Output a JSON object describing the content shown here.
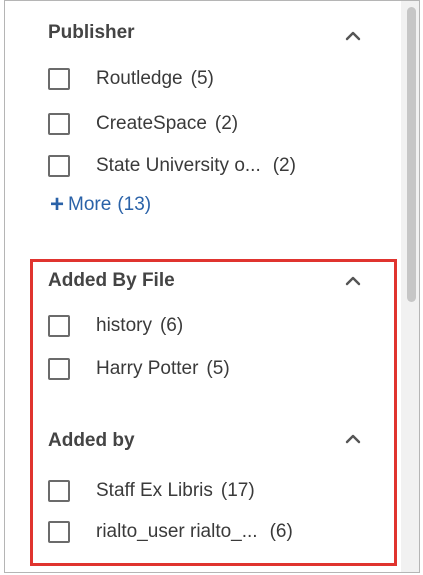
{
  "facets": {
    "publisher": {
      "title": "Publisher",
      "toggle_icon": "chevron-up-icon",
      "options": [
        {
          "label": "Routledge",
          "count": "(5)"
        },
        {
          "label": "CreateSpace",
          "count": "(2)"
        },
        {
          "label": "State University o...",
          "count": "(2)"
        }
      ],
      "more": {
        "label": "More",
        "count": "(13)"
      }
    },
    "added_by_file": {
      "title": "Added By File",
      "toggle_icon": "chevron-up-icon",
      "options": [
        {
          "label": "history",
          "count": "(6)"
        },
        {
          "label": "Harry Potter",
          "count": "(5)"
        }
      ]
    },
    "added_by": {
      "title": "Added by",
      "toggle_icon": "chevron-up-icon",
      "options": [
        {
          "label": "Staff Ex Libris",
          "count": "(17)"
        },
        {
          "label": "rialto_user rialto_...",
          "count": "(6)"
        }
      ]
    }
  },
  "colors": {
    "link": "#2a62a8",
    "highlight_border": "#e0342f",
    "checkbox_border": "#6b6b6b"
  }
}
